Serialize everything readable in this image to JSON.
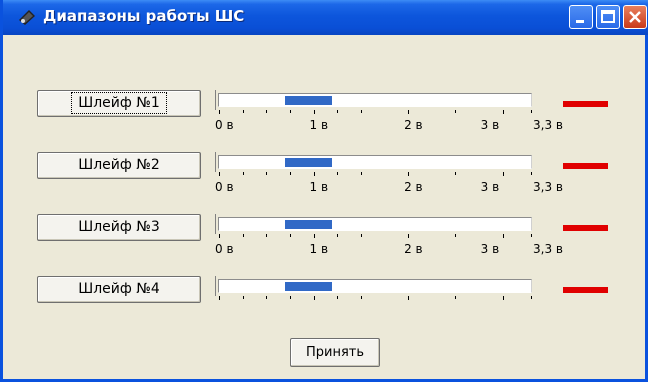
{
  "window": {
    "title": "Диапазоны работы ШС"
  },
  "loops": [
    {
      "label": "Шлейф №1",
      "range_low": 0.7,
      "range_high": 1.2,
      "status_color": "#e00000"
    },
    {
      "label": "Шлейф №2",
      "range_low": 0.7,
      "range_high": 1.2,
      "status_color": "#e00000"
    },
    {
      "label": "Шлейф №3",
      "range_low": 0.7,
      "range_high": 1.2,
      "status_color": "#e00000"
    },
    {
      "label": "Шлейф №4",
      "range_low": 0.7,
      "range_high": 1.2,
      "status_color": "#e00000"
    }
  ],
  "scale": {
    "min": 0,
    "max": 3.3,
    "labels": [
      {
        "text": "0 в",
        "value": 0
      },
      {
        "text": "1 в",
        "value": 1
      },
      {
        "text": "2 в",
        "value": 2
      },
      {
        "text": "3 в",
        "value": 3
      },
      {
        "text": "3,3 в",
        "value": 3.3
      }
    ],
    "ticks": [
      0,
      0.25,
      0.5,
      0.75,
      1.0,
      1.25,
      1.5,
      2.0,
      2.5,
      3.0,
      3.3
    ]
  },
  "accept_button": "Принять",
  "colors": {
    "range_fill": "#3169c6",
    "status_alarm": "#e00000"
  },
  "icons": {
    "window_icon": "app-icon",
    "minimize": "minimize-icon",
    "maximize": "maximize-icon",
    "close": "close-icon"
  }
}
